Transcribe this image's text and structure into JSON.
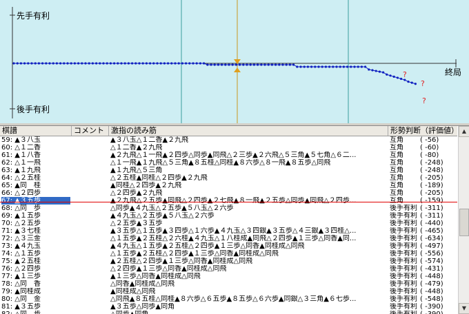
{
  "graph": {
    "label_top": "先手有利",
    "label_bottom": "後手有利",
    "label_end": "終局",
    "marker_question": "?",
    "colors": {
      "background": "#ceeef3",
      "line": "#1020c0",
      "current": "#e0a020",
      "bad": "#e02020"
    }
  },
  "list": {
    "headers": [
      "棋譜",
      "コメント",
      "激指の読み筋",
      "形勢判断（評価値）"
    ],
    "rows": [
      {
        "move": "59: ▲３八玉",
        "comment": "",
        "line": "▲３八玉△１二香▲２九飛",
        "judge": "互角",
        "value": "(    -56)"
      },
      {
        "move": "60: △１二香",
        "comment": "",
        "line": "△１二香▲２九飛",
        "judge": "互角",
        "value": "(    -60)"
      },
      {
        "move": "61: ▲１八香",
        "comment": "",
        "line": "▲２九飛△１一飛▲２四歩△同歩▲同飛△２三歩▲２六飛△５三角▲５七角△６二...",
        "judge": "互角",
        "value": "(    -80)"
      },
      {
        "move": "62: △１一飛",
        "comment": "",
        "line": "△１一飛▲１九飛△５三角▲８五桂△同桂▲８六歩△８一飛▲８五歩△同飛",
        "judge": "互角",
        "value": "(   -248)"
      },
      {
        "move": "63: ▲１九飛",
        "comment": "",
        "line": "▲１九飛△５三角",
        "judge": "互角",
        "value": "(   -248)"
      },
      {
        "move": "64: △２五桂",
        "comment": "",
        "line": "△２五桂▲同桂△２四歩▲２九飛",
        "judge": "互角",
        "value": "(   -205)"
      },
      {
        "move": "65: ▲同　桂",
        "comment": "",
        "line": "▲同桂△２四歩▲２九飛",
        "judge": "互角",
        "value": "(   -189)"
      },
      {
        "move": "66: △２四歩",
        "comment": "",
        "line": "△２四歩▲２九飛",
        "judge": "互角",
        "value": "(   -205)"
      },
      {
        "move": "67: ▲３五歩",
        "comment": "",
        "line": "▲２九飛△２五歩▲同飛△２四歩▲２七飛▲８一飛▲２五歩△同歩▲同飛△２四歩...",
        "judge": "互角",
        "value": "(   -159)",
        "selected": true
      },
      {
        "move": "68: △同　歩",
        "comment": "",
        "line": "△同歩▲４九玉△２五歩▲５八玉△２六歩",
        "judge": "後手有利",
        "value": "(   -311)"
      },
      {
        "move": "69: ▲１五歩",
        "comment": "",
        "line": "▲４九玉△２五歩▲５八玉△２六歩",
        "judge": "後手有利",
        "value": "(   -311)"
      },
      {
        "move": "70: △２五歩",
        "comment": "",
        "line": "△２五歩▲３五歩",
        "judge": "後手有利",
        "value": "(   -440)"
      },
      {
        "move": "71: ▲３七桂",
        "comment": "",
        "line": "▲３五歩△１五歩▲３四歩△１六歩▲４九玉△３四銀▲３五歩△４三銀▲３四桂△...",
        "judge": "後手有利",
        "value": "(   -465)"
      },
      {
        "move": "72: △３三金",
        "comment": "",
        "line": "△１五歩▲２五桂△２六桂▲４九玉△１八桂成▲同飛△２四歩▲１三歩△同香▲同...",
        "judge": "後手有利",
        "value": "(   -634)"
      },
      {
        "move": "73: ▲４九玉",
        "comment": "",
        "line": "▲４九玉△１五歩▲２五桂△２四歩▲１三歩△同香▲同桂成△同飛",
        "judge": "後手有利",
        "value": "(   -497)"
      },
      {
        "move": "74: △１五歩",
        "comment": "",
        "line": "△１五歩▲２五桂△２四歩▲１三歩△同香▲同桂成△同飛",
        "judge": "後手有利",
        "value": "(   -556)"
      },
      {
        "move": "75: ▲２五桂",
        "comment": "",
        "line": "▲２五桂△２四歩▲１三歩△同香▲同桂成△同飛",
        "judge": "後手有利",
        "value": "(   -574)"
      },
      {
        "move": "76: △２四歩",
        "comment": "",
        "line": "△２四歩▲１三歩△同香▲同桂成△同飛",
        "judge": "後手有利",
        "value": "(   -431)"
      },
      {
        "move": "77: ▲１三歩",
        "comment": "",
        "line": "▲１三歩△同香▲同桂成△同飛",
        "judge": "後手有利",
        "value": "(   -448)"
      },
      {
        "move": "78: △同　香",
        "comment": "",
        "line": "△同香▲同桂成△同飛",
        "judge": "後手有利",
        "value": "(   -479)"
      },
      {
        "move": "79: ▲同桂成",
        "comment": "",
        "line": "▲同桂成△同飛",
        "judge": "後手有利",
        "value": "(   -448)"
      },
      {
        "move": "80: △同　金",
        "comment": "",
        "line": "△同飛▲８五桂△同桂▲８六歩△６五歩▲８五歩△６六歩▲同銀△３三角▲６七歩...",
        "judge": "後手有利",
        "value": "(   -548)"
      },
      {
        "move": "81: ▲３五歩",
        "comment": "",
        "line": "▲３五歩△同歩▲同角",
        "judge": "後手有利",
        "value": "(   -390)"
      },
      {
        "move": "82: △同　歩",
        "comment": "",
        "line": "△同歩▲同角",
        "judge": "後手有利",
        "value": "(   -390)"
      }
    ]
  }
}
